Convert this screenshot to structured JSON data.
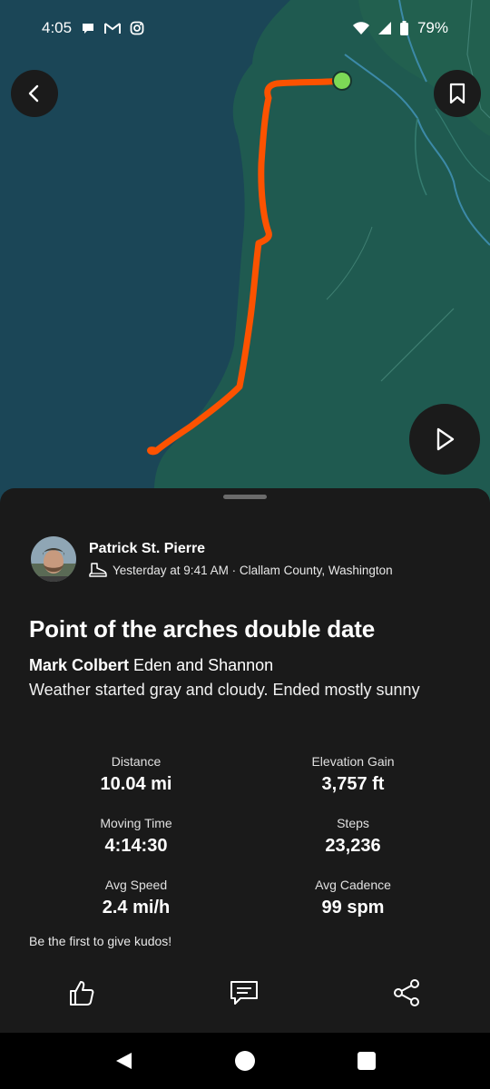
{
  "status_bar": {
    "time": "4:05",
    "battery": "79%"
  },
  "map": {
    "colors": {
      "water": "#1b4657",
      "land": "#1f5a50",
      "route": "#fc5200",
      "start_marker": "#7dd956"
    }
  },
  "activity": {
    "athlete_name": "Patrick St. Pierre",
    "meta": "Yesterday at 9:41 AM · Clallam County, Washington",
    "title": "Point of the arches double date",
    "tagged_user": "Mark Colbert",
    "tagged_others": " Eden and Shannon",
    "description": "Weather started gray and cloudy. Ended mostly sunny",
    "stats": {
      "distance": {
        "label": "Distance",
        "value": "10.04 mi"
      },
      "elevation": {
        "label": "Elevation Gain",
        "value": "3,757 ft"
      },
      "moving_time": {
        "label": "Moving Time",
        "value": "4:14:30"
      },
      "steps": {
        "label": "Steps",
        "value": "23,236"
      },
      "avg_speed": {
        "label": "Avg Speed",
        "value": "2.4 mi/h"
      },
      "avg_cadence": {
        "label": "Avg Cadence",
        "value": "99 spm"
      }
    },
    "kudos_prompt": "Be the first to give kudos!"
  },
  "icons": {
    "back": "arrow-left-icon",
    "bookmark": "bookmark-icon",
    "play": "play-icon",
    "hike": "hiking-boot-icon",
    "kudos": "thumbs-up-icon",
    "comment": "comment-icon",
    "share": "share-icon"
  }
}
